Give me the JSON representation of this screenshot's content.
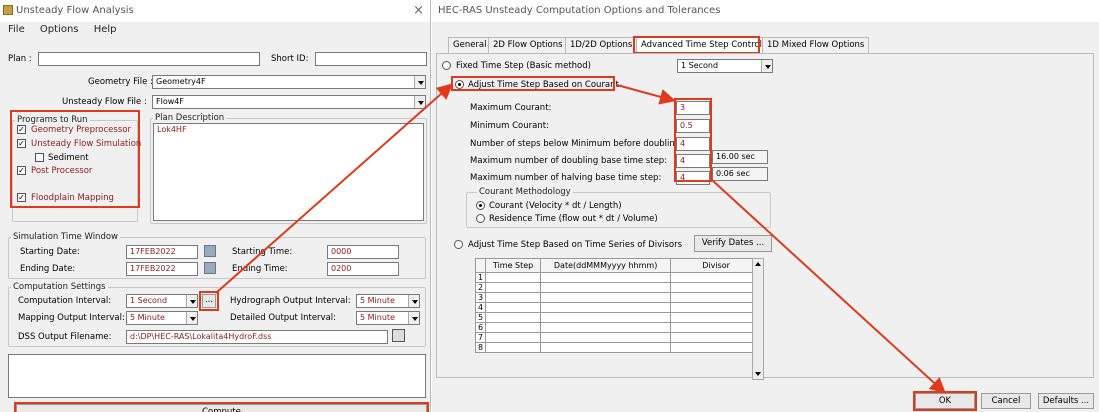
{
  "w1": {
    "title": "Unsteady Flow Analysis",
    "close": "×",
    "menu": [
      "File",
      "Options",
      "Help"
    ],
    "plan_label": "Plan :",
    "plan_value": "",
    "short_id_label": "Short ID:",
    "short_id_value": "",
    "geom_label": "Geometry File :",
    "geom_value": "Geometry4F",
    "flow_label": "Unsteady Flow File :",
    "flow_value": "Flow4F",
    "programs_title": "Programs to Run",
    "programs": [
      {
        "label": "Geometry Preprocessor",
        "checked": true
      },
      {
        "label": "Unsteady Flow Simulation",
        "checked": true
      },
      {
        "label": "Sediment",
        "checked": false
      },
      {
        "label": "Post Processor",
        "checked": true
      },
      {
        "label": "Floodplain Mapping",
        "checked": true
      }
    ],
    "plan_desc_title": "Plan Description",
    "plan_desc": "Lok4HF",
    "time_title": "Simulation Time Window",
    "start_date_label": "Starting Date:",
    "start_date": "17FEB2022",
    "end_date_label": "Ending Date:",
    "end_date": "17FEB2022",
    "start_time_label": "Starting Time:",
    "start_time": "0000",
    "end_time_label": "Ending Time:",
    "end_time": "0200",
    "comp_title": "Computation Settings",
    "comp_int_label": "Computation Interval:",
    "comp_int": "1 Second",
    "ellipsis": "...",
    "hydro_label": "Hydrograph Output Interval:",
    "hydro": "5 Minute",
    "map_label": "Mapping Output Interval:",
    "map": "5 Minute",
    "detail_label": "Detailed Output Interval:",
    "detail": "5 Minute",
    "dss_label": "DSS Output Filename:",
    "dss": "d:\\DP\\HEC-RAS\\Lokalita4HydroF.dss",
    "compute": "Compute"
  },
  "w2": {
    "title": "HEC-RAS Unsteady Computation Options and Tolerances",
    "tabs": [
      "General",
      "2D Flow Options",
      "1D/2D Options",
      "Advanced Time Step Control",
      "1D Mixed Flow Options"
    ],
    "fixed_label": "Fixed Time Step (Basic method)",
    "fixed_value": "1 Second",
    "courant_label": "Adjust Time Step Based on Courant",
    "max_courant_label": "Maximum Courant:",
    "max_courant": "3",
    "min_courant_label": "Minimum Courant:",
    "min_courant": "0.5",
    "steps_label": "Number of steps below Minimum before doubling:",
    "steps": "4",
    "doubling_label": "Maximum number of doubling base time step:",
    "doubling": "4",
    "doubling_sec": "16.00 sec",
    "halving_label": "Maximum number of halving base time step:",
    "halving": "4",
    "halving_sec": "0.06 sec",
    "method_title": "Courant Methodology",
    "method1": "Courant (Velocity * dt / Length)",
    "method2": "Residence Time (flow out * dt / Volume)",
    "divisors_label": "Adjust Time Step Based on Time Series of Divisors",
    "verify": "Verify Dates ...",
    "cols": [
      "Time Step",
      "Date(ddMMMyyyy hhmm)",
      "Divisor"
    ],
    "rows": [
      "1",
      "2",
      "3",
      "4",
      "5",
      "6",
      "7",
      "8"
    ],
    "ok": "OK",
    "cancel": "Cancel",
    "defaults": "Defaults ..."
  }
}
